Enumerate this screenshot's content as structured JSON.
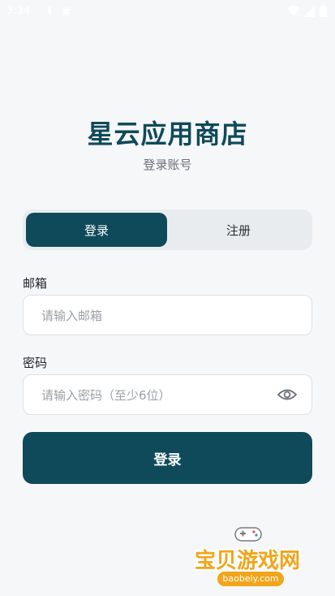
{
  "status_bar": {
    "time": "3:34",
    "icons": [
      "download-icon",
      "media-icon",
      "wifi-icon",
      "signal-icon",
      "battery-icon"
    ]
  },
  "header": {
    "title": "星云应用商店",
    "subtitle": "登录账号"
  },
  "tabs": [
    {
      "label": "登录",
      "active": true
    },
    {
      "label": "注册",
      "active": false
    }
  ],
  "form": {
    "email": {
      "label": "邮箱",
      "placeholder": "请输入邮箱",
      "value": ""
    },
    "password": {
      "label": "密码",
      "placeholder": "请输入密码（至少6位）",
      "value": ""
    },
    "submit_label": "登录"
  },
  "watermark": {
    "brand": "宝贝游戏网",
    "url": "baobeiy.com"
  },
  "colors": {
    "primary": "#0f4a5a",
    "background": "#f6f7f9",
    "watermark": "#f1a51a"
  }
}
